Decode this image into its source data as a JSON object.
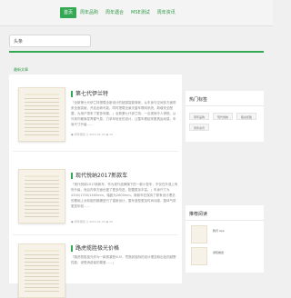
{
  "nav": {
    "items": [
      {
        "label": "首页",
        "active": true
      },
      {
        "label": "周年品购"
      },
      {
        "label": "周年遇合"
      },
      {
        "label": "MSE测试"
      },
      {
        "label": "周年资讯"
      }
    ]
  },
  "search": {
    "value": "头条"
  },
  "section_label": "最新文章",
  "articles": [
    {
      "title": "第七代伊兰特",
      "desc": "「全新第七代伊兰特搭载全新设计的超感智能驾驶，从车身与空间多方面带来全面突破，开启全新可能。同时搭载全景天窗车联网系统，新增安全配置，为用户带来了更多惊喜。」全新第七代伊兰特，一出现就令人惊艳，从外到内都焕发青春气息，力求年轻化的设计，让整车看起来更具运动感，车身尺寸升级……",
      "author": "周年潮流",
      "date": "2023-02-04",
      "views": "19"
    },
    {
      "title": "现代悦纳2017新款车",
      "desc": "「现代悦纳2017新款车，作为现代品牌旗下的一款小型车，不仅在外观上有所升级，而且内饰方面也做了更多改进，配置更加丰富。」车身尺寸为4300/1700/1460mm，轴距为2600mm。新款车在保持了原有设计理念的基础上对前脸的格栅进行了重新设计，整车造型更加时尚动感，整体气质更显年轻……",
      "author": "周年潮流",
      "date": "2023-02-04",
      "views": "30"
    },
    {
      "title": "路虎揽胜极光价格",
      "desc": "「路虎揽胜极光作为一款紧凑型SUV，凭借其独特的设计理念和出色的越野性能，深受消费者的喜爱……」",
      "author": "周年潮流",
      "date": "2023-02-04",
      "views": "24"
    }
  ],
  "sidebar": {
    "hot_tags_title": "热门标签",
    "tags": [
      "周年品购",
      "现代悦纳",
      "路虎揽胜",
      "周年资讯"
    ],
    "recommend_title": "推荐阅读",
    "recommend": [
      {
        "title": "腾讯 App"
      },
      {
        "title": "通知推送"
      }
    ]
  },
  "colors": {
    "accent": "#34a853"
  }
}
